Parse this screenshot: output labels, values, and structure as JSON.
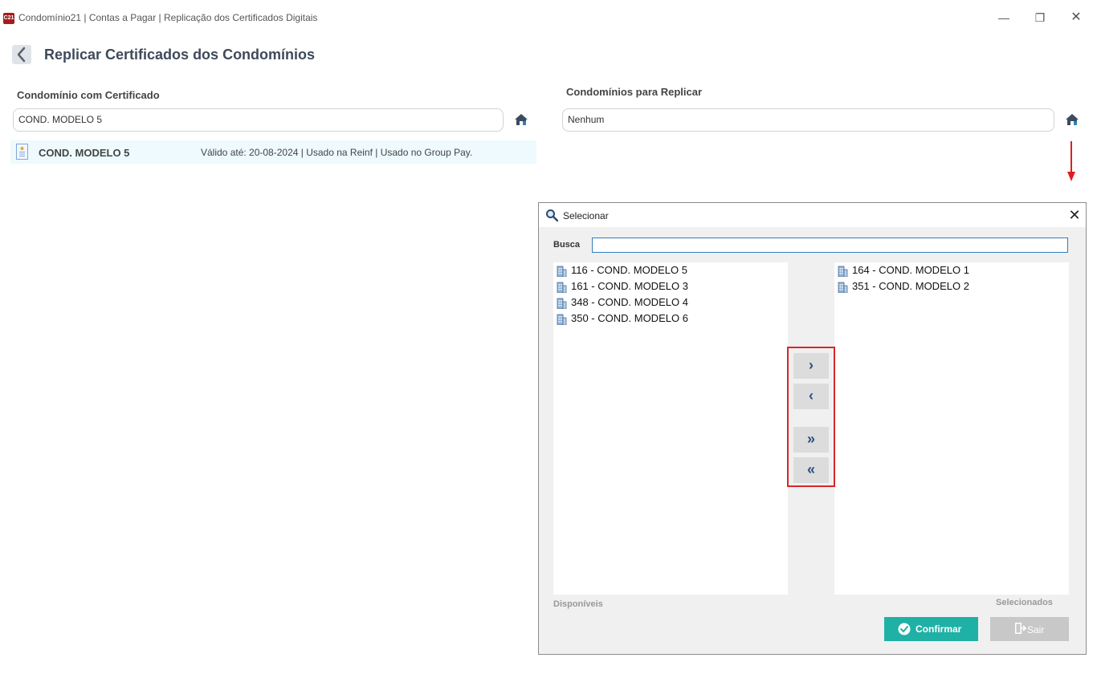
{
  "window": {
    "logo_text": "C21",
    "title": "Condomínio21 | Contas a Pagar | Replicação dos Certificados Digitais",
    "minimize": "—",
    "restore": "❐",
    "close": "✕"
  },
  "page": {
    "title": "Replicar Certificados dos Condomínios"
  },
  "left": {
    "label": "Condomínio com Certificado",
    "value": "COND. MODELO 5"
  },
  "right": {
    "label": "Condomínios para Replicar",
    "value": "Nenhum"
  },
  "certificate": {
    "name": "COND. MODELO 5",
    "info": "Válido até: 20-08-2024 | Usado na Reinf | Usado no Group Pay."
  },
  "dialog": {
    "title": "Selecionar",
    "close": "✕",
    "search_label": "Busca",
    "search_value": "",
    "available": [
      "116 - COND. MODELO 5",
      "161 - COND. MODELO 3",
      "348 - COND. MODELO 4",
      "350 - COND. MODELO 6"
    ],
    "selected": [
      "164 - COND. MODELO 1",
      "351 - COND. MODELO 2"
    ],
    "available_label": "Disponíveis",
    "selected_label": "Selecionados",
    "move_right": "›",
    "move_left": "‹",
    "move_all_right": "»",
    "move_all_left": "«",
    "confirm": "Confirmar",
    "exit": "Sair"
  },
  "icons": {
    "back": "chevron-left-icon",
    "home": "home-icon",
    "certificate": "certificate-icon",
    "building": "building-icon",
    "search": "magnifier-icon",
    "check": "check-circle-icon",
    "exit": "door-exit-icon"
  },
  "colors": {
    "accent": "#1fb1a6",
    "highlight_border": "#d9262c",
    "title": "#3e4a5b",
    "row_bg": "#eefafd"
  }
}
